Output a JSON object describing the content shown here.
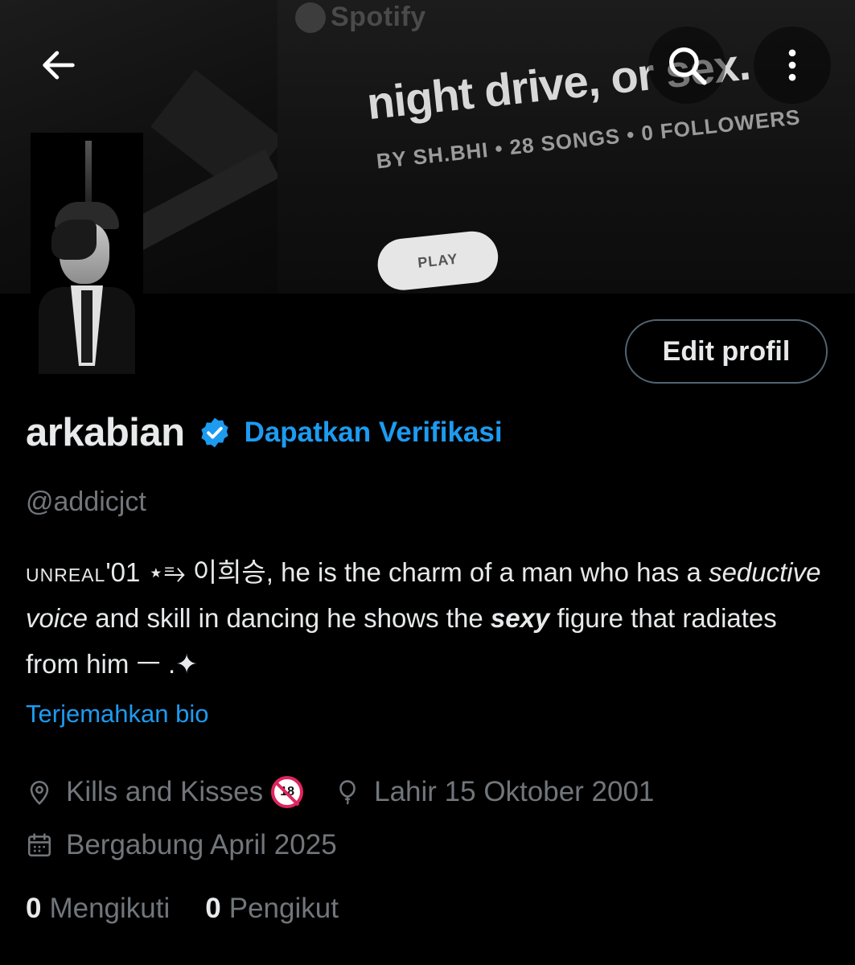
{
  "banner": {
    "brand": "Spotify",
    "playlist_title": "night drive, or sex.",
    "playlist_meta": "BY SH.BHI • 28 SONGS • 0 FOLLOWERS",
    "play_label": "PLAY"
  },
  "nav": {
    "back_icon": "arrow-left-icon",
    "search_icon": "search-icon",
    "more_icon": "more-vertical-icon"
  },
  "profile": {
    "edit_label": "Edit profil",
    "display_name": "arkabian",
    "get_verified_label": "Dapatkan Verifikasi",
    "handle": "@addicjct",
    "bio": {
      "prefix": "unreal",
      "part1": "'01 ⋆⥱ 이희승, he is the charm of a man who has a ",
      "italic1": "seductive voice",
      "part2": " and skill in dancing he shows the ",
      "bold_italic": "sexy",
      "part3": " figure that radiates from him ㅡ .✦"
    },
    "translate_label": "Terjemahkan bio",
    "location": "Kills and Kisses",
    "location_badge": "18",
    "birth": "Lahir 15 Oktober 2001",
    "joined": "Bergabung April 2025",
    "following_count": "0",
    "following_label": "Mengikuti",
    "followers_count": "0",
    "followers_label": "Pengikut"
  },
  "colors": {
    "background": "#000000",
    "text": "#e7e9ea",
    "muted": "#71767b",
    "accent": "#1d9bf0",
    "border": "#536471"
  }
}
